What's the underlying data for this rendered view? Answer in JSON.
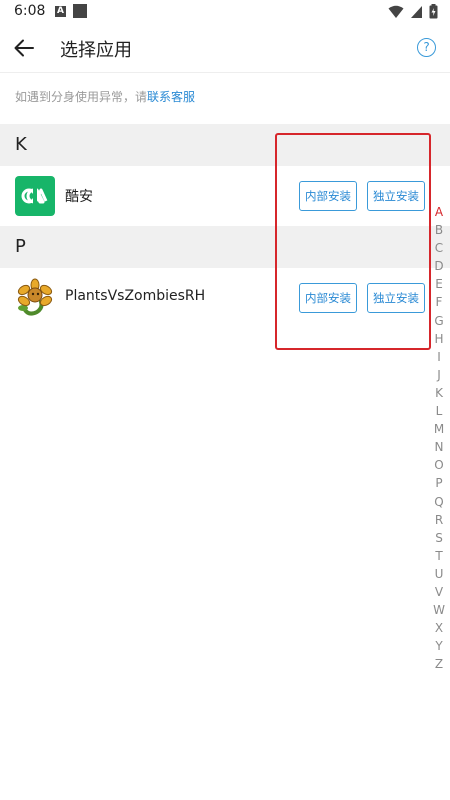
{
  "status_bar": {
    "time": "6:08",
    "notification_icon_letter": "A"
  },
  "header": {
    "title": "选择应用",
    "help_icon_glyph": "?"
  },
  "notice": {
    "text": "如遇到分身使用异常，请",
    "link": "联系客服"
  },
  "sections": [
    {
      "letter": "K",
      "apps": [
        {
          "name": "酷安",
          "icon": "coolapk-icon",
          "internal_label": "内部安装",
          "standalone_label": "独立安装"
        }
      ]
    },
    {
      "letter": "P",
      "apps": [
        {
          "name": "PlantsVsZombiesRH",
          "icon": "plants-vs-zombies-icon",
          "internal_label": "内部安装",
          "standalone_label": "独立安装"
        }
      ]
    }
  ],
  "index_letters": [
    "A",
    "B",
    "C",
    "D",
    "E",
    "F",
    "G",
    "H",
    "I",
    "J",
    "K",
    "L",
    "M",
    "N",
    "O",
    "P",
    "Q",
    "R",
    "S",
    "T",
    "U",
    "V",
    "W",
    "X",
    "Y",
    "Z"
  ],
  "index_active": "A",
  "colors": {
    "accent": "#2a8ad4",
    "highlight": "#d6262b",
    "section_bg": "#f0f0f0",
    "coolapk_green": "#17b569"
  }
}
